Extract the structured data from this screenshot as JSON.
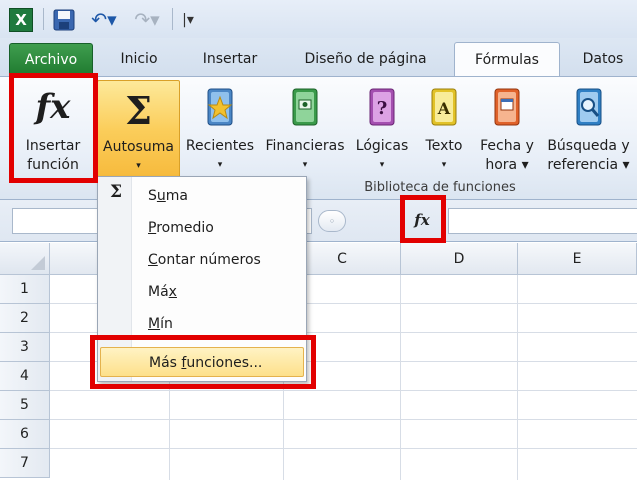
{
  "qat": {
    "excel_glyph": "X",
    "undo_glyph": "↶▾",
    "redo_glyph": "↷▾",
    "customize_glyph": "|▾"
  },
  "tabs": [
    {
      "label": "Archivo"
    },
    {
      "label": "Inicio"
    },
    {
      "label": "Insertar"
    },
    {
      "label": "Diseño de página"
    },
    {
      "label": "Fórmulas"
    },
    {
      "label": "Datos"
    }
  ],
  "ribbon": {
    "insertar_funcion": {
      "icon": "fx",
      "line1": "Insertar",
      "line2": "función"
    },
    "autosuma": {
      "icon": "Σ",
      "line1": "Autosuma",
      "arrow": "▾"
    },
    "recientes": {
      "line1": "Recientes",
      "arrow": "▾"
    },
    "financieras": {
      "line1": "Financieras",
      "arrow": "▾"
    },
    "logicas": {
      "line1": "Lógicas",
      "arrow": "▾"
    },
    "texto": {
      "line1": "Texto",
      "arrow": "▾"
    },
    "fecha": {
      "line1": "Fecha y",
      "line2": "hora ▾"
    },
    "busqueda": {
      "line1": "Búsqueda y",
      "line2": "referencia ▾"
    },
    "group_label": "Biblioteca de funciones"
  },
  "formula_bar": {
    "fx_label": "fx",
    "knob_glyph": "◦"
  },
  "sheet": {
    "columns": [
      "C",
      "D",
      "E"
    ],
    "rows": [
      "1",
      "2",
      "3",
      "4",
      "5",
      "6",
      "7"
    ]
  },
  "dropdown": {
    "sigma": "Σ",
    "items": [
      {
        "pre": "S",
        "ul": "u",
        "post": "ma"
      },
      {
        "pre": "",
        "ul": "P",
        "post": "romedio"
      },
      {
        "pre": "",
        "ul": "C",
        "post": "ontar números"
      },
      {
        "pre": "Má",
        "ul": "x",
        "post": ""
      },
      {
        "pre": "",
        "ul": "M",
        "post": "ín"
      },
      {
        "pre": "Más ",
        "ul": "f",
        "post": "unciones..."
      }
    ]
  },
  "colors": {
    "highlight": "#e20000",
    "archivo_tab": "#2a8a3c",
    "autosuma_active": "#fbcd5a"
  }
}
